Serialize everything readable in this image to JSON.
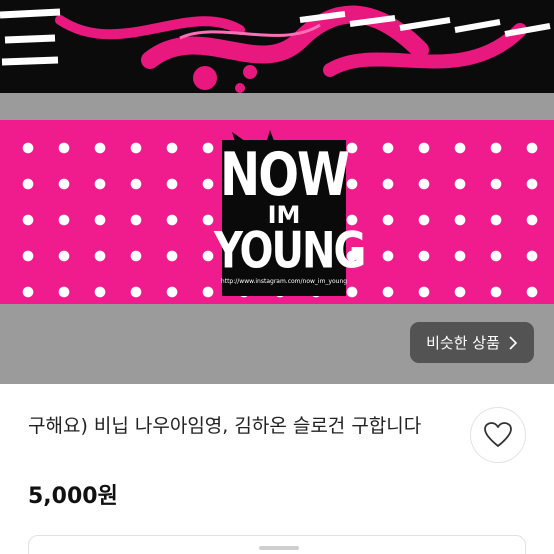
{
  "image": {
    "logo": {
      "line1": "NOW",
      "line2": "IM",
      "line3": "YOUNG",
      "url": "http://www.instagram.com/now_im_young"
    },
    "colors": {
      "pink": "#f01c8e",
      "black": "#0b0b0b",
      "gray": "#9b9b9b"
    }
  },
  "similar_button": {
    "label": "비슷한 상품",
    "icon": "chevron-right-icon"
  },
  "product": {
    "title": "구해요) 비닙 나우아임영, 김하온 슬로건 구합니다",
    "price": "5,000원"
  },
  "actions": {
    "like_icon": "heart-outline-icon"
  }
}
